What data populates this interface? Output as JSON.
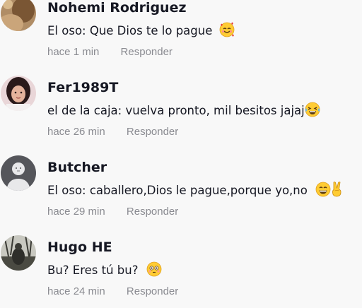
{
  "comments": [
    {
      "username": "Nohemi Rodriguez",
      "text": "El oso: Que Dios te lo pague",
      "emoji": "smiling-face-with-hearts",
      "time": "hace 1 min",
      "reply_label": "Responder"
    },
    {
      "username": "Fer1989T",
      "text": "el de la caja: vuelva pronto, mil besitos jajaj",
      "emoji": "tears-of-joy",
      "time": "hace 26 min",
      "reply_label": "Responder"
    },
    {
      "username": "Butcher",
      "text": "El oso: caballero,Dios le pague,porque yo,no",
      "emoji": "grinning-face-and-victory-hand",
      "time": "hace 29 min",
      "reply_label": "Responder"
    },
    {
      "username": "Hugo HE",
      "text": "Bu? Eres tú bu?",
      "emoji": "flushed-face",
      "time": "hace 24 min",
      "reply_label": "Responder"
    }
  ],
  "colors": {
    "background": "#f8f8f8",
    "username": "#161823",
    "meta": "#8a8b91"
  }
}
